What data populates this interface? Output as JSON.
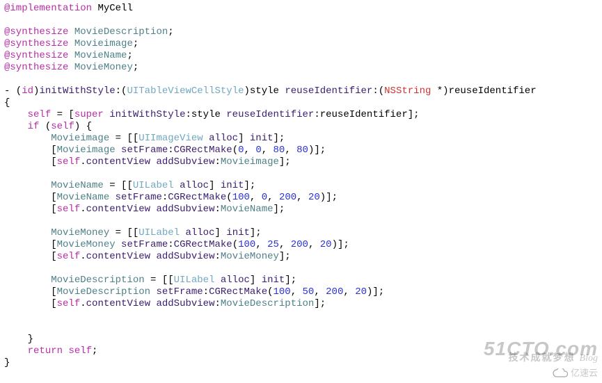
{
  "code": {
    "class_name": "MyCell",
    "synth": [
      "MovieDescription",
      "Movieimage",
      "MovieName",
      "MovieMoney"
    ],
    "method": {
      "return_type": "id",
      "name_part1": "initWithStyle",
      "name_part2": "style reuseIdentifier",
      "style_type": "UITableViewCellStyle",
      "reuse_type": "NSString",
      "reuse_arg": "reuseIdentifier"
    },
    "body": {
      "super_call": "[super initWithStyle:style reuseIdentifier:reuseIdentifier]",
      "image": {
        "var": "Movieimage",
        "cls": "UIImageView",
        "frame": [
          0,
          0,
          80,
          80
        ]
      },
      "name": {
        "var": "MovieName",
        "cls": "UILabel",
        "frame": [
          100,
          0,
          200,
          20
        ]
      },
      "money": {
        "var": "MovieMoney",
        "cls": "UILabel",
        "frame": [
          100,
          25,
          200,
          20
        ]
      },
      "desc": {
        "var": "MovieDescription",
        "cls": "UILabel",
        "frame": [
          100,
          50,
          200,
          20
        ]
      }
    },
    "tokens": {
      "impl": "@implementation",
      "synth": "@synthesize",
      "self": "self",
      "super": "super",
      "if": "if",
      "return": "return",
      "alloc": "alloc",
      "init": "init",
      "setFrame": "setFrame",
      "cgrect": "CGRectMake",
      "contentView": "contentView",
      "addSubview": "addSubview",
      "initWithStyle": "initWithStyle",
      "reuseIdentifier_sel": "reuseIdentifier"
    }
  },
  "watermark": {
    "site": "51CTO.com",
    "tagline_cn": "技术成就梦想",
    "tagline_blog": "Blog",
    "brand_cn": "亿速云"
  }
}
